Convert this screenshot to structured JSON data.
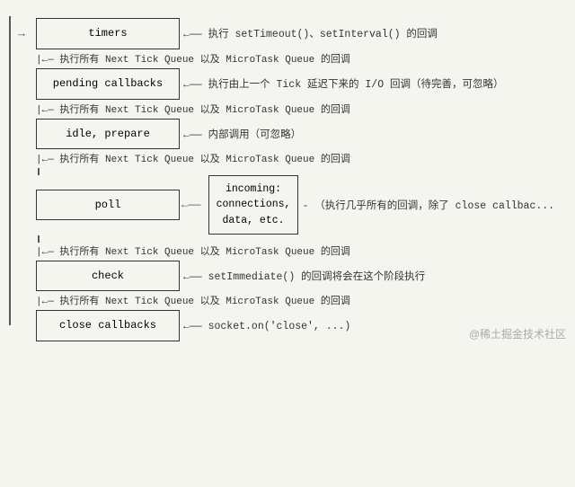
{
  "phases": [
    {
      "id": "timers",
      "label": "timers",
      "description": "←—— 执行 setTimeout()、setInterval() 的回调"
    },
    {
      "id": "pending-callbacks",
      "label": "pending callbacks",
      "description": "←—— 执行由上一个 Tick 延迟下来的 I/O 回调（待完善，可忽略）"
    },
    {
      "id": "idle-prepare",
      "label": "idle, prepare",
      "description": "←—— 内部调用（可忽略）"
    },
    {
      "id": "poll",
      "label": "poll",
      "incoming_label": "incoming:\nconnections,\ndata, etc.",
      "description": "- （执行几乎所有的回调，除了 close callbac..."
    },
    {
      "id": "check",
      "label": "check",
      "description": "←—— setImmediate() 的回调将会在这个阶段执行"
    },
    {
      "id": "close-callbacks",
      "label": "close callbacks",
      "description": "←—— socket.on('close', ...)"
    }
  ],
  "tick_text": "|←— 执行所有 Next Tick Queue 以及 MicroTask Queue 的回调",
  "loop_indicator": "→",
  "watermark": "@稀土掘金技术社区"
}
